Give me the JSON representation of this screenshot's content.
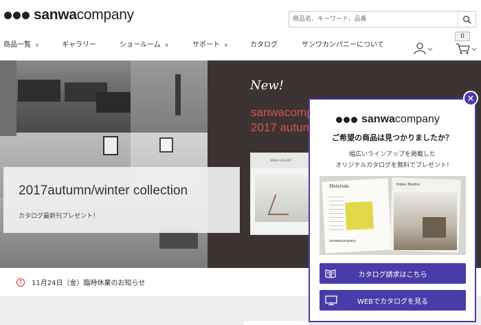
{
  "header": {
    "logo_bold": "sanwa",
    "logo_rest": "company",
    "search_placeholder": "商品名、キーワード、品番",
    "cart_count": "0"
  },
  "nav": {
    "items": [
      {
        "label": "商品一覧",
        "dropdown": true
      },
      {
        "label": "ギャラリー",
        "dropdown": false
      },
      {
        "label": "ショールーム",
        "dropdown": true
      },
      {
        "label": "サポート",
        "dropdown": true
      },
      {
        "label": "カタログ",
        "dropdown": false
      },
      {
        "label": "サンワカンパニーについて",
        "dropdown": false
      }
    ]
  },
  "hero": {
    "new_tag": "New!",
    "brand_text": "sanwacomp",
    "year_text": "2017 autum",
    "collection_title": "2017autumn/winter collection",
    "collection_sub": "カタログ最新刊プレゼント！",
    "catalog_mock_title": "WASH GALLERY"
  },
  "notice": {
    "text": "11月24日（金）臨時休業のお知らせ"
  },
  "popup": {
    "logo_bold": "sanwa",
    "logo_rest": "company",
    "title": "ご希望の商品は見つかりましたか？",
    "desc_line1": "幅広いラインアップを掲載した",
    "desc_line2": "オリジナルカタログを無料でプレゼント!",
    "image_label1": "Materials",
    "image_label2": "Pollen Mullins",
    "image_logo": "sanwacompany",
    "request_button": "カタログ請求はこちら",
    "web_button": "WEBでカタログを見る",
    "close_symbol": "×"
  },
  "colors": {
    "accent": "#4a3ca8",
    "hero_bg": "#3b3433",
    "hero_red": "#d9534f",
    "notice_red": "#d03030"
  }
}
